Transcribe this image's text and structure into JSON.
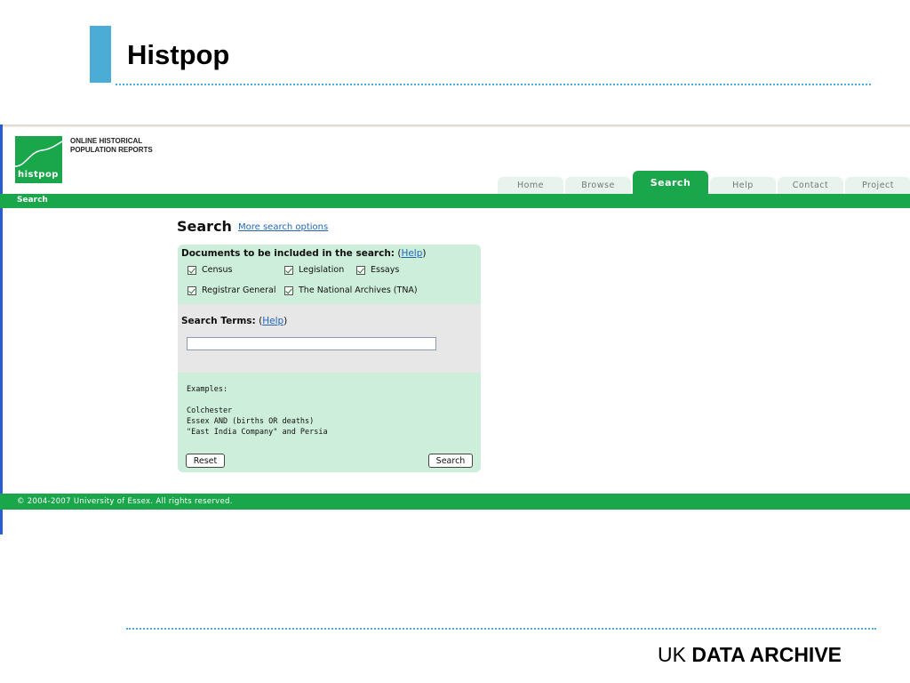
{
  "slide": {
    "title": "Histpop",
    "brand_prefix": "UK",
    "brand_bold": "DATA ARCHIVE"
  },
  "logo": {
    "text": "histpop",
    "caption_line1": "ONLINE HISTORICAL",
    "caption_line2": "POPULATION REPORTS"
  },
  "nav": {
    "tabs": [
      {
        "label": "Home",
        "active": false
      },
      {
        "label": "Browse",
        "active": false
      },
      {
        "label": "Search",
        "active": true
      },
      {
        "label": "Help",
        "active": false
      },
      {
        "label": "Contact",
        "active": false
      },
      {
        "label": "Project",
        "active": false
      }
    ],
    "breadcrumb": "Search"
  },
  "search": {
    "heading": "Search",
    "more_options_link": "More search options",
    "documents_label": "Documents to be included in the search:",
    "help_link": "Help",
    "checkboxes": [
      {
        "label": "Census",
        "checked": true
      },
      {
        "label": "Legislation",
        "checked": true
      },
      {
        "label": "Essays",
        "checked": true
      },
      {
        "label": "Registrar General",
        "checked": true
      },
      {
        "label": "The National Archives (TNA)",
        "checked": true
      }
    ],
    "terms_label": "Search Terms:",
    "terms_value": "",
    "examples_label": "Examples:",
    "examples": [
      "Colchester",
      "Essex AND (births OR deaths)",
      "\"East India Company\" and Persia"
    ],
    "reset_label": "Reset",
    "search_label": "Search"
  },
  "footer": {
    "copyright": "© 2004-2007  University of Essex. All rights reserved."
  },
  "colors": {
    "accent_green": "#1aa64a",
    "panel_green": "#cdeeda",
    "slide_blue": "#4bacd6",
    "link_blue": "#1f66b8"
  }
}
